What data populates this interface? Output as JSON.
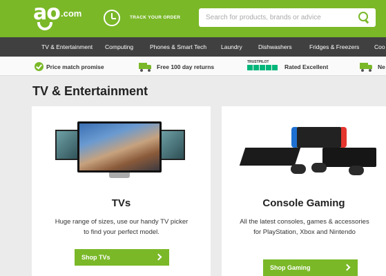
{
  "header": {
    "logo_text": "ao",
    "logo_suffix": ".com",
    "track_label": "TRACK YOUR ORDER",
    "search_placeholder": "Search for products, brands or advice",
    "brand_color": "#7ab828"
  },
  "nav": {
    "items": [
      "TV & Entertainment",
      "Computing",
      "Phones & Smart Tech",
      "Laundry",
      "Dishwashers",
      "Fridges & Freezers",
      "Coo"
    ]
  },
  "promo": {
    "items": [
      {
        "icon": "check-circle-icon",
        "label": "Price match promise"
      },
      {
        "icon": "truck-icon",
        "label": "Free 100 day returns"
      },
      {
        "icon": "trustpilot-icon",
        "badge": "TRUSTPILOT",
        "label": "Rated Excellent"
      },
      {
        "icon": "truck-icon",
        "label": "Ne"
      }
    ]
  },
  "page": {
    "title": "TV & Entertainment"
  },
  "cards": [
    {
      "title": "TVs",
      "description": "Huge range of sizes, use our handy TV picker to find your perfect model.",
      "cta": "Shop TVs"
    },
    {
      "title": "Console Gaming",
      "description": "All the latest consoles, games & accessories for PlayStation, Xbox and Nintendo",
      "cta": "Shop Gaming"
    }
  ]
}
